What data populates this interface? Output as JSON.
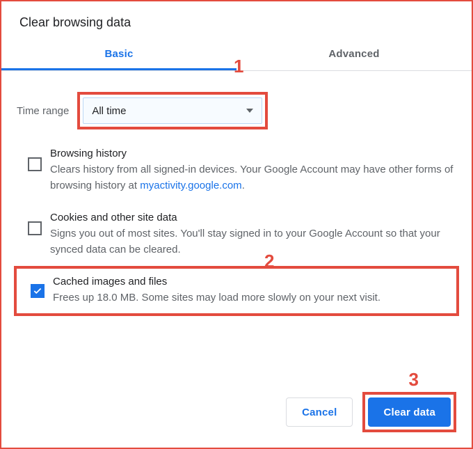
{
  "title": "Clear browsing data",
  "tabs": {
    "basic": "Basic",
    "advanced": "Advanced"
  },
  "time": {
    "label": "Time range",
    "value": "All time"
  },
  "options": {
    "history": {
      "title": "Browsing history",
      "desc_pre": "Clears history from all signed-in devices. Your Google Account may have other forms of browsing history at ",
      "link": "myactivity.google.com",
      "desc_post": "."
    },
    "cookies": {
      "title": "Cookies and other site data",
      "desc": "Signs you out of most sites. You'll stay signed in to your Google Account so that your synced data can be cleared."
    },
    "cache": {
      "title": "Cached images and files",
      "desc": "Frees up 18.0 MB. Some sites may load more slowly on your next visit."
    }
  },
  "buttons": {
    "cancel": "Cancel",
    "clear": "Clear data"
  },
  "annotations": {
    "a1": "1",
    "a2": "2",
    "a3": "3"
  }
}
